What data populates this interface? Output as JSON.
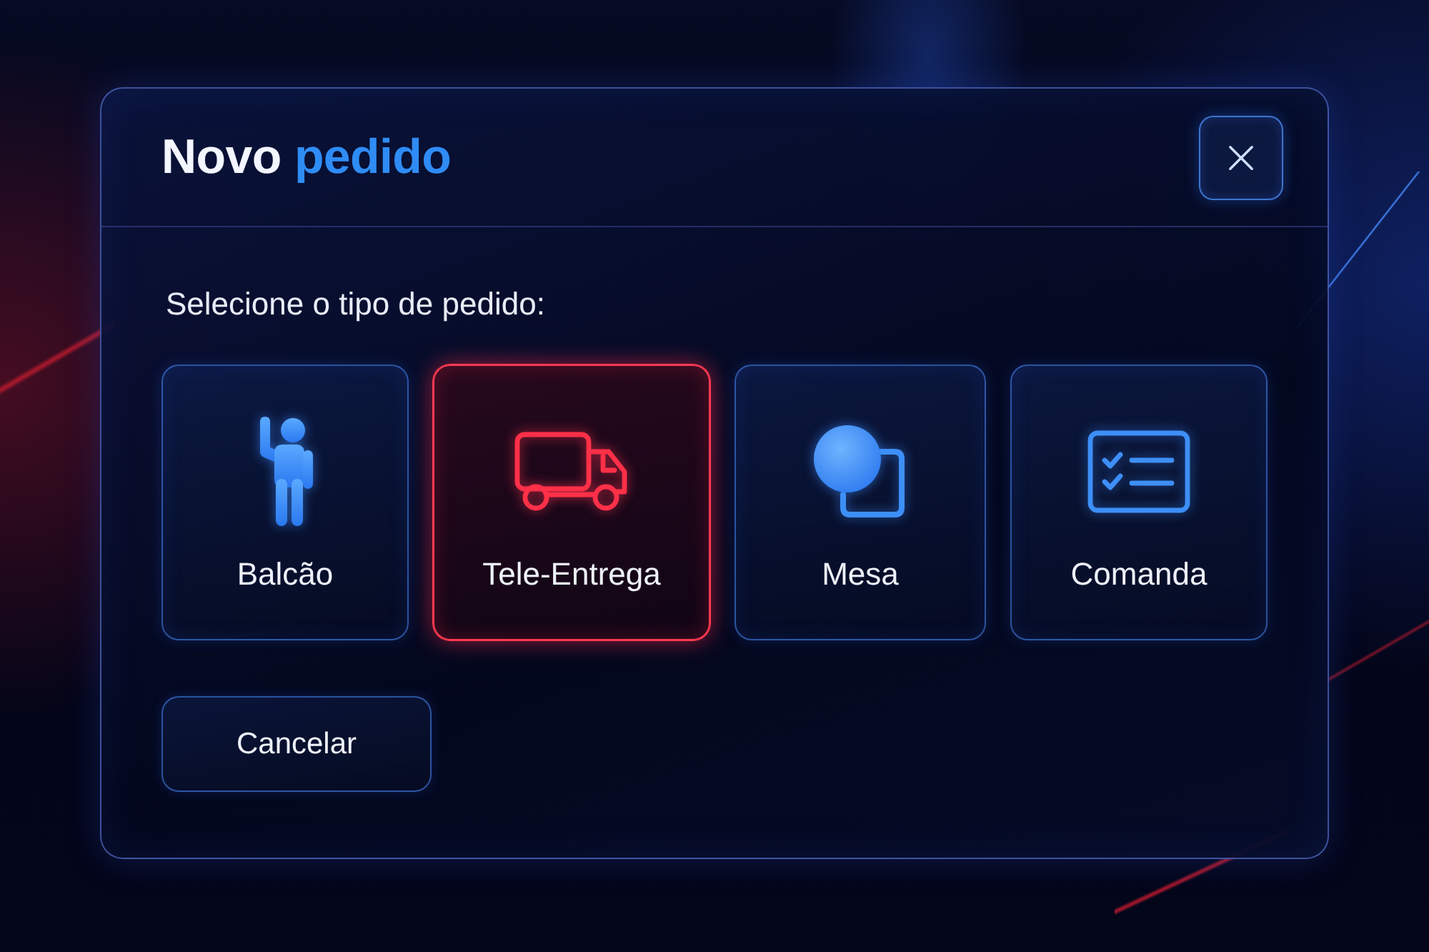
{
  "dialog": {
    "title": [
      {
        "text": "Novo",
        "accent": false
      },
      {
        "text": "pedido",
        "accent": true
      }
    ],
    "prompt": "Selecione o tipo de pedido:",
    "options": [
      {
        "label": "Balcão",
        "selected": false
      },
      {
        "label": "Tele-Entrega",
        "selected": true
      },
      {
        "label": "Mesa",
        "selected": false
      },
      {
        "label": "Comanda",
        "selected": false
      }
    ],
    "cancel_button": {
      "label": "Cancelar"
    }
  }
}
